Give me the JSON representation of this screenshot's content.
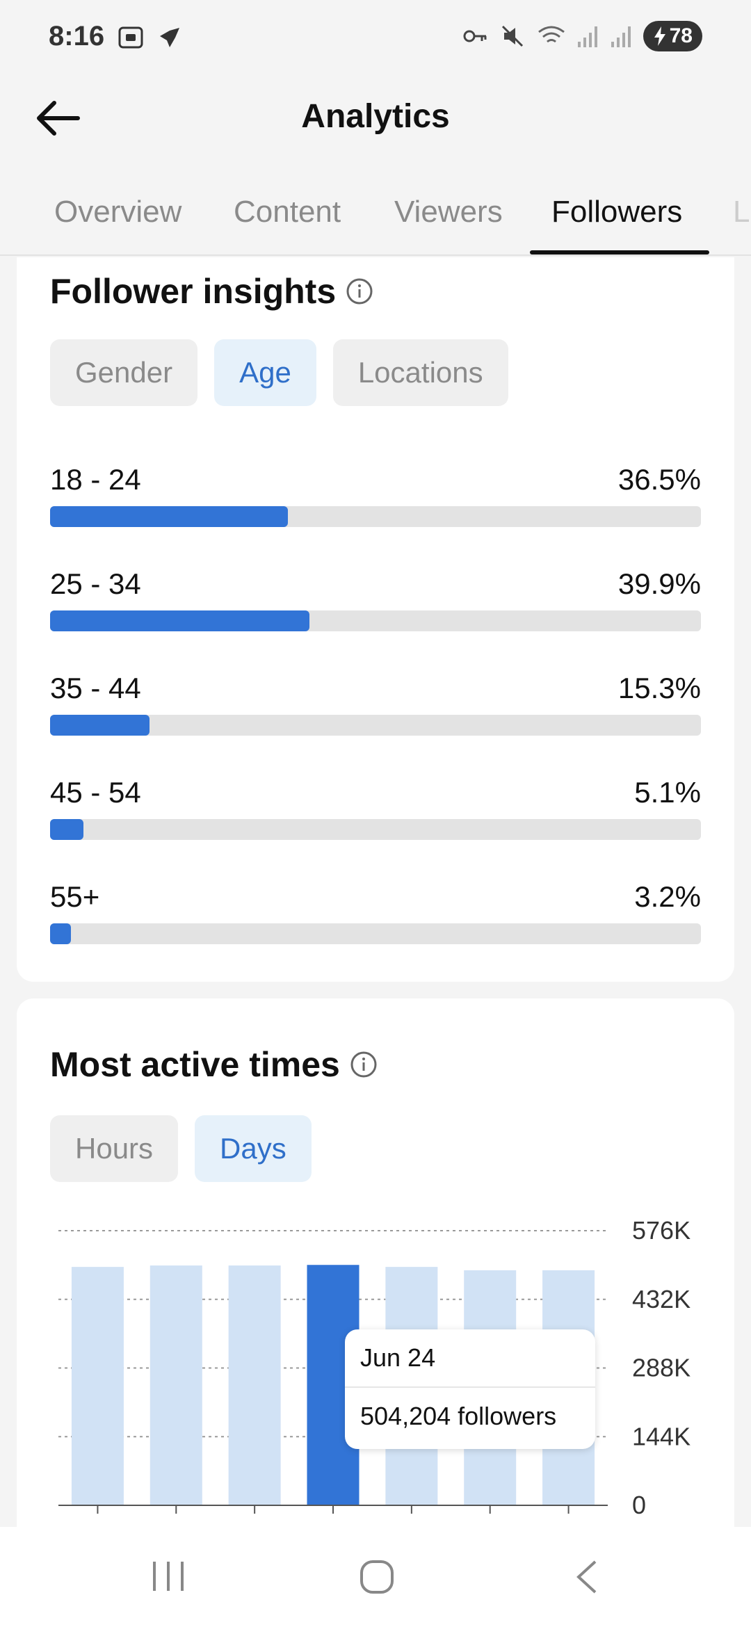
{
  "status": {
    "time": "8:16",
    "battery": "78"
  },
  "header": {
    "title": "Analytics"
  },
  "tabs": [
    {
      "label": "Overview",
      "active": false
    },
    {
      "label": "Content",
      "active": false
    },
    {
      "label": "Viewers",
      "active": false
    },
    {
      "label": "Followers",
      "active": true
    },
    {
      "label": "L",
      "active": false
    }
  ],
  "insights": {
    "title": "Follower insights",
    "chips": [
      {
        "label": "Gender",
        "active": false
      },
      {
        "label": "Age",
        "active": true
      },
      {
        "label": "Locations",
        "active": false
      }
    ],
    "age_groups": [
      {
        "label": "18 - 24",
        "value": "36.5%",
        "fraction": 0.365
      },
      {
        "label": "25 - 34",
        "value": "39.9%",
        "fraction": 0.399
      },
      {
        "label": "35 - 44",
        "value": "15.3%",
        "fraction": 0.153
      },
      {
        "label": "45 - 54",
        "value": "5.1%",
        "fraction": 0.051
      },
      {
        "label": "55+",
        "value": "3.2%",
        "fraction": 0.032
      }
    ]
  },
  "active_times": {
    "title": "Most active times",
    "chips": [
      {
        "label": "Hours",
        "active": false
      },
      {
        "label": "Days",
        "active": true
      }
    ],
    "tooltip": {
      "date": "Jun 24",
      "value": "504,204 followers"
    }
  },
  "chart_data": {
    "type": "bar",
    "categories": [
      "",
      "",
      "",
      "",
      "",
      "",
      ""
    ],
    "values": [
      500000,
      503000,
      503000,
      504204,
      500000,
      493000,
      493000
    ],
    "highlighted_index": 3,
    "y_ticks": [
      "576K",
      "432K",
      "288K",
      "144K",
      "0"
    ],
    "ylim": [
      0,
      576000
    ],
    "grid": true,
    "colors": {
      "bar": "#d1e2f5",
      "highlight": "#3274d6"
    }
  },
  "colors": {
    "accent": "#3274d6",
    "track": "#e3e3e3",
    "chip_active_bg": "#e6f1fa"
  }
}
